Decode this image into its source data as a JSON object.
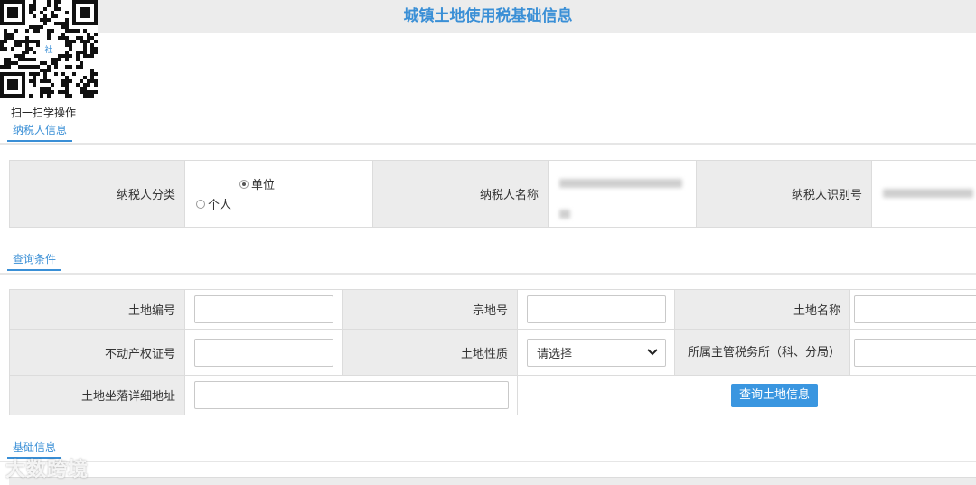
{
  "page": {
    "title": "城镇土地使用税基础信息"
  },
  "qr": {
    "caption": "扫一扫学操作",
    "center_label": "社"
  },
  "sections": {
    "taxpayer": "纳税人信息",
    "query": "查询条件",
    "basic": "基础信息"
  },
  "taxpayer": {
    "category_label": "纳税人分类",
    "options": [
      {
        "label": "单位",
        "checked": true
      },
      {
        "label": "个人",
        "checked": false
      }
    ],
    "name_label": "纳税人名称",
    "id_label": "纳税人识别号"
  },
  "query": {
    "land_no_label": "土地编号",
    "parcel_no_label": "宗地号",
    "land_name_label": "土地名称",
    "property_cert_label": "不动产权证号",
    "land_nature_label": "土地性质",
    "land_nature_value": "请选择",
    "tax_office_label": "所属主管税务所（科、分局）",
    "address_label": "土地坐落详细地址",
    "search_button": "查询土地信息"
  },
  "watermark": "大数跨境"
}
